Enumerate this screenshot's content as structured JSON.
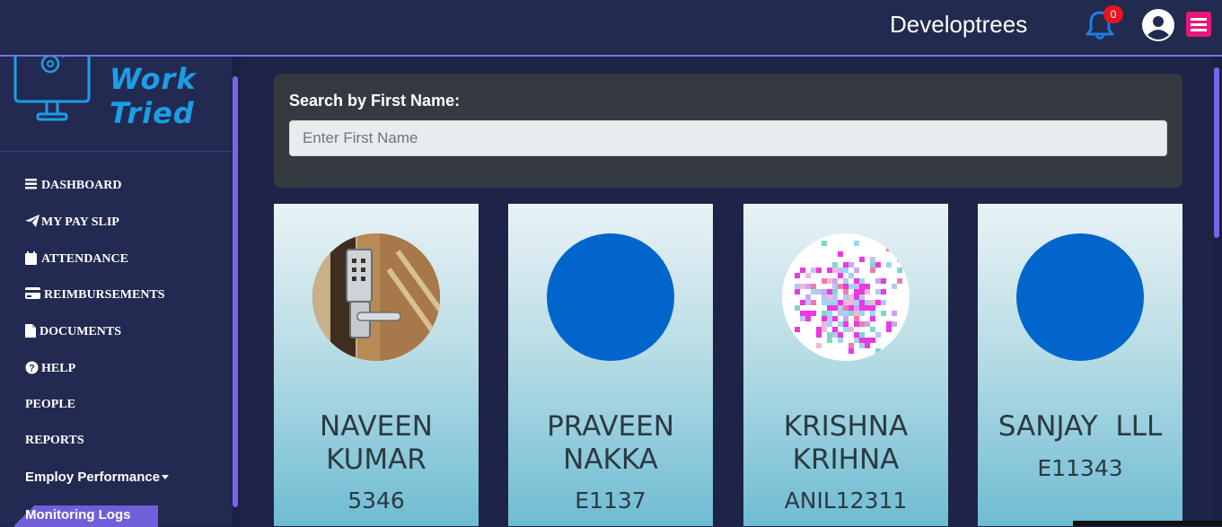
{
  "header": {
    "company": "Developtrees",
    "notification_count": "0"
  },
  "sidebar": {
    "logo_text": "Work Tried",
    "items": [
      {
        "label": "DASHBOARD",
        "icon": "bars-icon"
      },
      {
        "label": "MY PAY SLIP",
        "icon": "paper-plane-icon"
      },
      {
        "label": "ATTENDANCE",
        "icon": "calendar-icon"
      },
      {
        "label": "REIMBURSEMENTS",
        "icon": "credit-card-icon"
      },
      {
        "label": "DOCUMENTS",
        "icon": "file-icon"
      },
      {
        "label": "HELP",
        "icon": "question-circle-icon"
      },
      {
        "label": "PEOPLE"
      },
      {
        "label": "REPORTS"
      },
      {
        "label": "Employ Performance",
        "icon": "caret-down-icon"
      },
      {
        "label": "Monitoring Logs"
      }
    ]
  },
  "search": {
    "label": "Search by First Name:",
    "placeholder": "Enter First Name",
    "value": ""
  },
  "employees": [
    {
      "name": "NAVEEN\nKUMAR",
      "code": "5346",
      "avatar": "door-lock-photo"
    },
    {
      "name": "PRAVEEN\nNAKKA",
      "code": "E1137",
      "avatar": "blue-circle"
    },
    {
      "name": "KRISHNA\nKRIHNA",
      "code": "ANIL12311",
      "avatar": "pixel-pattern"
    },
    {
      "name": "SANJAY  LLL",
      "code": "E11343",
      "avatar": "blue-circle"
    }
  ],
  "colors": {
    "header_bg": "#212a4f",
    "accent": "#7b6fe0",
    "menu_button": "#e8177a",
    "bell": "#1e7fe6",
    "avatar_blue": "#0066cc"
  }
}
